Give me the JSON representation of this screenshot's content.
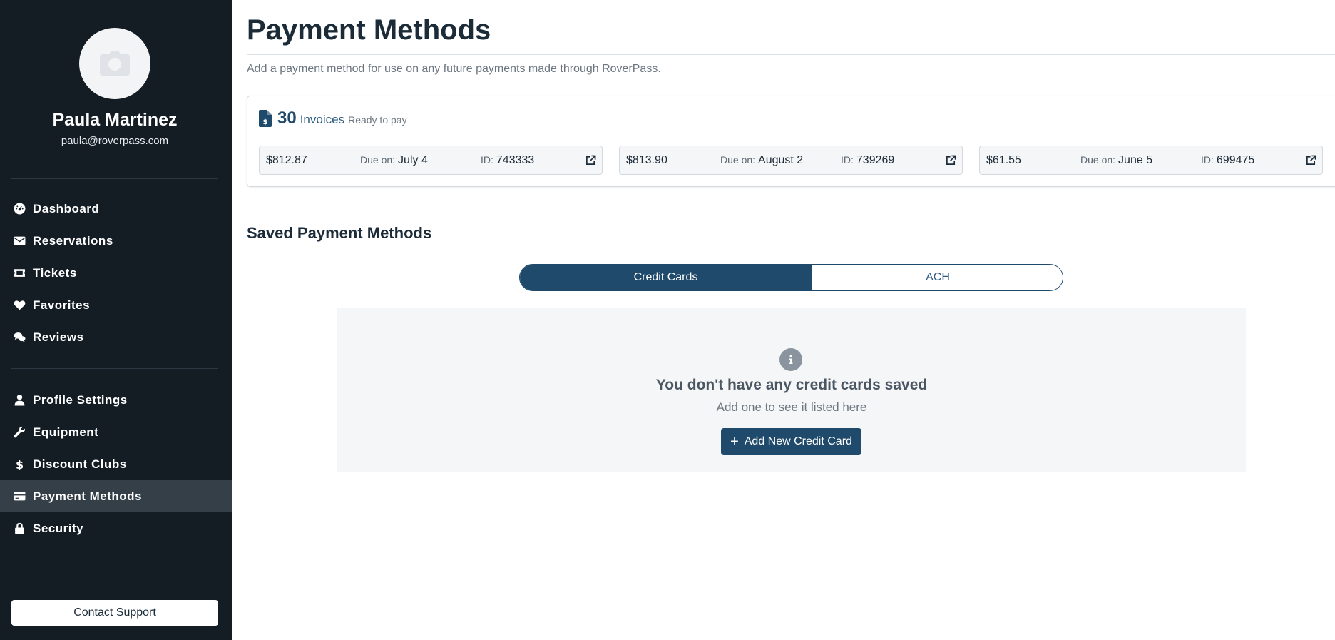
{
  "sidebar": {
    "user": {
      "name": "Paula Martinez",
      "email": "paula@roverpass.com"
    },
    "nav_primary": [
      {
        "label": "Dashboard",
        "icon": "dashboard-icon"
      },
      {
        "label": "Reservations",
        "icon": "envelope-icon"
      },
      {
        "label": "Tickets",
        "icon": "ticket-icon"
      },
      {
        "label": "Favorites",
        "icon": "heart-icon"
      },
      {
        "label": "Reviews",
        "icon": "comments-icon"
      }
    ],
    "nav_secondary": [
      {
        "label": "Profile Settings",
        "icon": "user-icon"
      },
      {
        "label": "Equipment",
        "icon": "wrench-icon"
      },
      {
        "label": "Discount Clubs",
        "icon": "dollar-icon"
      },
      {
        "label": "Payment Methods",
        "icon": "credit-card-icon",
        "active": true
      },
      {
        "label": "Security",
        "icon": "lock-icon"
      }
    ],
    "contact_support": "Contact Support"
  },
  "main": {
    "title": "Payment Methods",
    "subtitle": "Add a payment method for use on any future payments made through RoverPass.",
    "invoices": {
      "count": "30",
      "label": "Invoices",
      "status": "Ready to pay",
      "items": [
        {
          "amount": "$812.87",
          "due_label": "Due on:",
          "due": "July 4",
          "id_label": "ID:",
          "id": "743333"
        },
        {
          "amount": "$813.90",
          "due_label": "Due on:",
          "due": "August 2",
          "id_label": "ID:",
          "id": "739269"
        },
        {
          "amount": "$61.55",
          "due_label": "Due on:",
          "due": "June 5",
          "id_label": "ID:",
          "id": "699475"
        }
      ]
    },
    "saved": {
      "title": "Saved Payment Methods",
      "tabs": [
        "Credit Cards",
        "ACH"
      ],
      "active_tab": "Credit Cards",
      "empty_title": "You don't have any credit cards saved",
      "empty_subtitle": "Add one to see it listed here",
      "add_button": "Add New Credit Card"
    }
  },
  "colors": {
    "sidebar_bg": "#141c24",
    "active_nav_bg": "#343f48",
    "accent": "#1f4a6b",
    "panel_bg": "#f5f6f8"
  }
}
